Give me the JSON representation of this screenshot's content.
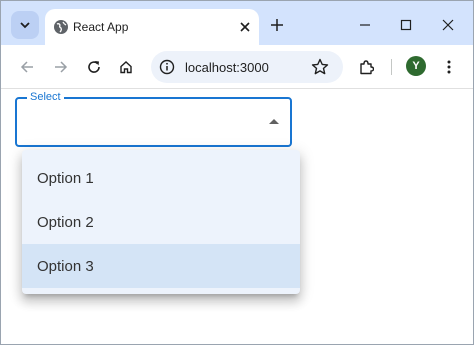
{
  "browser": {
    "tab": {
      "title": "React App"
    },
    "address": {
      "url": "localhost:3000"
    },
    "profile": {
      "initial": "Y",
      "color": "#2e6a2f"
    }
  },
  "page": {
    "select": {
      "label": "Select",
      "value": "",
      "accent_color": "#1976d2",
      "options": [
        {
          "label": "Option 1",
          "selected": false
        },
        {
          "label": "Option 2",
          "selected": false
        },
        {
          "label": "Option 3",
          "selected": true
        }
      ]
    }
  },
  "icons": [
    "tab-search-icon",
    "globe-icon",
    "close-icon",
    "plus-icon",
    "minimize-icon",
    "maximize-icon",
    "back-icon",
    "forward-icon",
    "reload-icon",
    "home-icon",
    "info-icon",
    "star-icon",
    "extensions-icon",
    "menu-icon",
    "dropdown-arrow-icon"
  ]
}
